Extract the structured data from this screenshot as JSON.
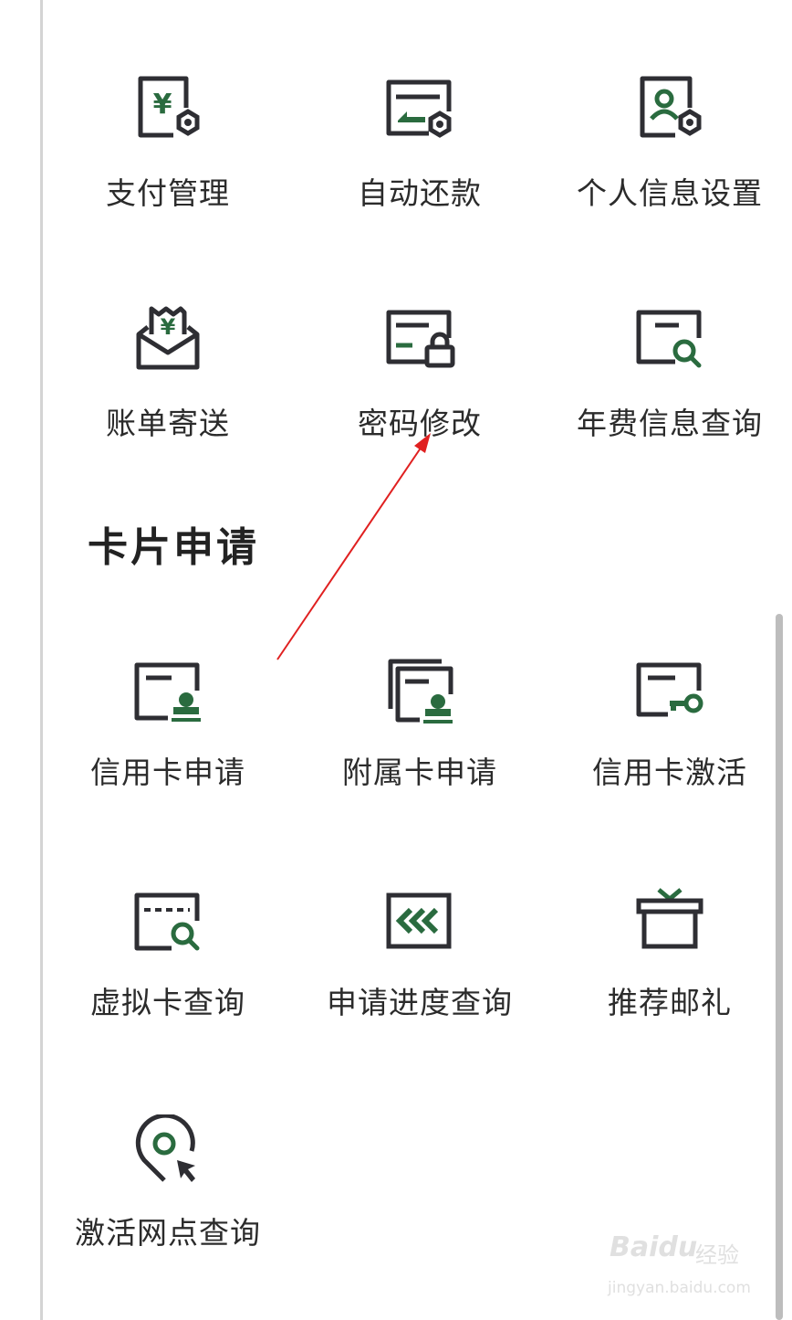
{
  "sections": [
    {
      "title": "",
      "items": [
        {
          "label": "支付管理",
          "icon": "payment-settings-icon"
        },
        {
          "label": "自动还款",
          "icon": "auto-repay-icon"
        },
        {
          "label": "个人信息设置",
          "icon": "profile-settings-icon"
        },
        {
          "label": "账单寄送",
          "icon": "bill-mail-icon"
        },
        {
          "label": "密码修改",
          "icon": "password-lock-icon"
        },
        {
          "label": "年费信息查询",
          "icon": "annual-fee-search-icon"
        }
      ]
    },
    {
      "title": "卡片申请",
      "items": [
        {
          "label": "信用卡申请",
          "icon": "card-apply-icon"
        },
        {
          "label": "附属卡申请",
          "icon": "supplementary-card-icon"
        },
        {
          "label": "信用卡激活",
          "icon": "card-activate-key-icon"
        },
        {
          "label": "虚拟卡查询",
          "icon": "virtual-card-search-icon"
        },
        {
          "label": "申请进度查询",
          "icon": "progress-query-icon"
        },
        {
          "label": "推荐邮礼",
          "icon": "gift-box-icon"
        },
        {
          "label": "激活网点查询",
          "icon": "branch-location-icon"
        }
      ]
    }
  ],
  "watermark": {
    "brand": "Baidu",
    "brand_cn": "经验",
    "url": "jingyan.baidu.com"
  },
  "colors": {
    "icon_dark": "#2e2e33",
    "icon_green": "#2a6b3f",
    "annotation_arrow": "#e02020",
    "text": "#2b2b2b"
  }
}
